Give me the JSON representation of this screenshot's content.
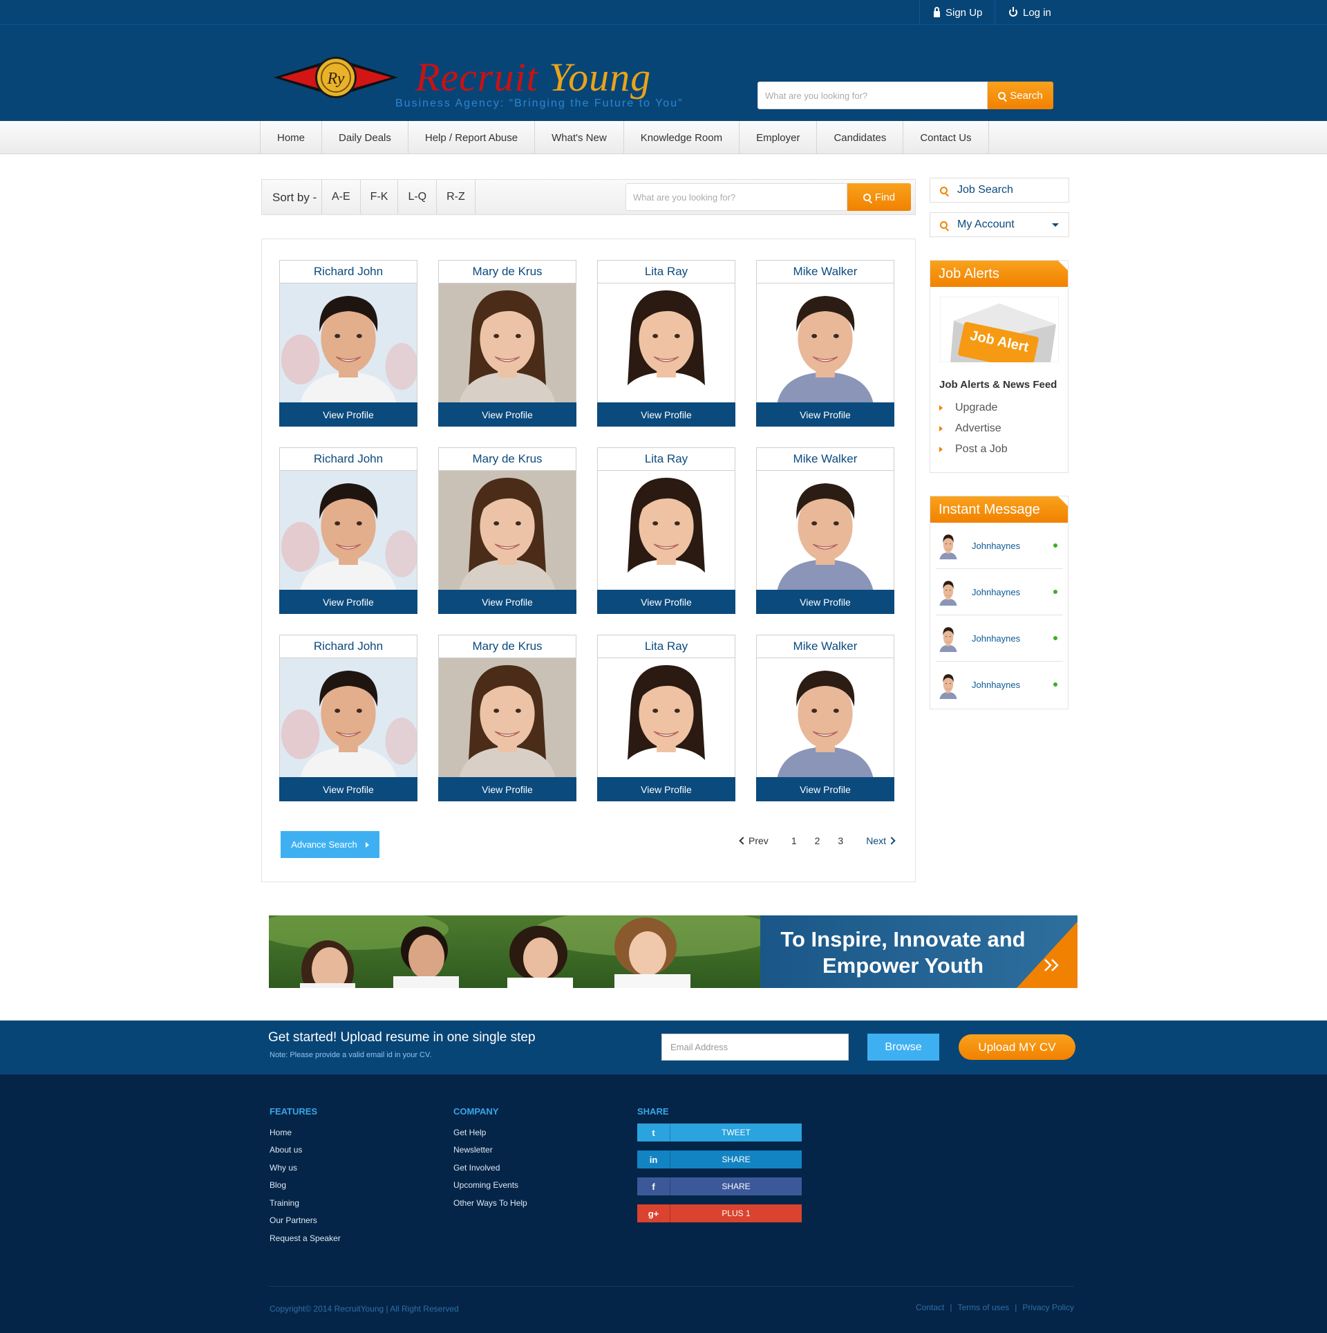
{
  "topbar": {
    "signup": "Sign Up",
    "login": "Log in"
  },
  "brand": {
    "title_part1": "Recruit",
    "title_part2": "Young",
    "tagline": "Business Agency: “Bringing the Future to You”",
    "monogram": "Ry"
  },
  "header_search": {
    "placeholder": "What are you looking for?",
    "button": "Search"
  },
  "nav": [
    "Home",
    "Daily Deals",
    "Help / Report Abuse",
    "What's New",
    "Knowledge Room",
    "Employer",
    "Candidates",
    "Contact Us"
  ],
  "sortbar": {
    "label": "Sort by -",
    "ranges": [
      "A-E",
      "F-K",
      "L-Q",
      "R-Z"
    ],
    "placeholder": "What are you looking for?",
    "button": "Find"
  },
  "candidates": [
    {
      "name": "Richard John",
      "action": "View Profile"
    },
    {
      "name": "Mary de Krus",
      "action": "View Profile"
    },
    {
      "name": "Lita Ray",
      "action": "View Profile"
    },
    {
      "name": "Mike Walker",
      "action": "View Profile"
    },
    {
      "name": "Richard John",
      "action": "View Profile"
    },
    {
      "name": "Mary de Krus",
      "action": "View Profile"
    },
    {
      "name": "Lita Ray",
      "action": "View Profile"
    },
    {
      "name": "Mike Walker",
      "action": "View Profile"
    },
    {
      "name": "Richard John",
      "action": "View Profile"
    },
    {
      "name": "Mary de Krus",
      "action": "View Profile"
    },
    {
      "name": "Lita Ray",
      "action": "View Profile"
    },
    {
      "name": "Mike Walker",
      "action": "View Profile"
    }
  ],
  "advance_search": "Advance Search",
  "pagination": {
    "prev": "Prev",
    "pages": [
      "1",
      "2",
      "3"
    ],
    "next": "Next"
  },
  "sidebar": {
    "job_search": "Job Search",
    "my_account": "My Account",
    "job_alerts": {
      "title": "Job Alerts",
      "image_text": "Job Alert",
      "heading": "Job Alerts & News Feed",
      "links": [
        "Upgrade",
        "Advertise",
        "Post a Job"
      ]
    },
    "instant_message": {
      "title": "Instant Message",
      "users": [
        "Johnhaynes",
        "Johnhaynes",
        "Johnhaynes",
        "Johnhaynes"
      ]
    }
  },
  "banner": {
    "line1": "To Inspire, Innovate and",
    "line2": "Empower Youth"
  },
  "upload": {
    "headline": "Get started! Upload resume in one single step",
    "note": "Note: Please provide a valid email id in your CV.",
    "email_placeholder": "Email Address",
    "browse": "Browse",
    "upload_button": "Upload MY CV"
  },
  "footer": {
    "features": {
      "title": "FEATURES",
      "links": [
        "Home",
        "About us",
        "Why us",
        "Blog",
        "Training",
        "Our Partners",
        "Request a Speaker"
      ]
    },
    "company": {
      "title": "COMPANY",
      "links": [
        "Get Help",
        "Newsletter",
        "Get Involved",
        "Upcoming Events",
        "Other Ways To Help"
      ]
    },
    "share": {
      "title": "SHARE",
      "buttons": [
        {
          "icon": "t",
          "label": "TWEET",
          "color": "#2aa3de"
        },
        {
          "icon": "in",
          "label": "SHARE",
          "color": "#1384c3"
        },
        {
          "icon": "f",
          "label": "SHARE",
          "color": "#3b5998"
        },
        {
          "icon": "g+",
          "label": "PLUS 1",
          "color": "#d9432f"
        }
      ]
    },
    "copyright": "Copyright© 2014 RecruitYoung  |  All Right Reserved",
    "bottom_links": [
      "Contact",
      "Terms of uses",
      "Privacy Policy"
    ]
  },
  "colors": {
    "brand_blue": "#084577",
    "accent_orange": "#f18100",
    "link_blue": "#0b4a7d",
    "light_blue": "#3eb0f2",
    "footer_bg": "#042548"
  }
}
